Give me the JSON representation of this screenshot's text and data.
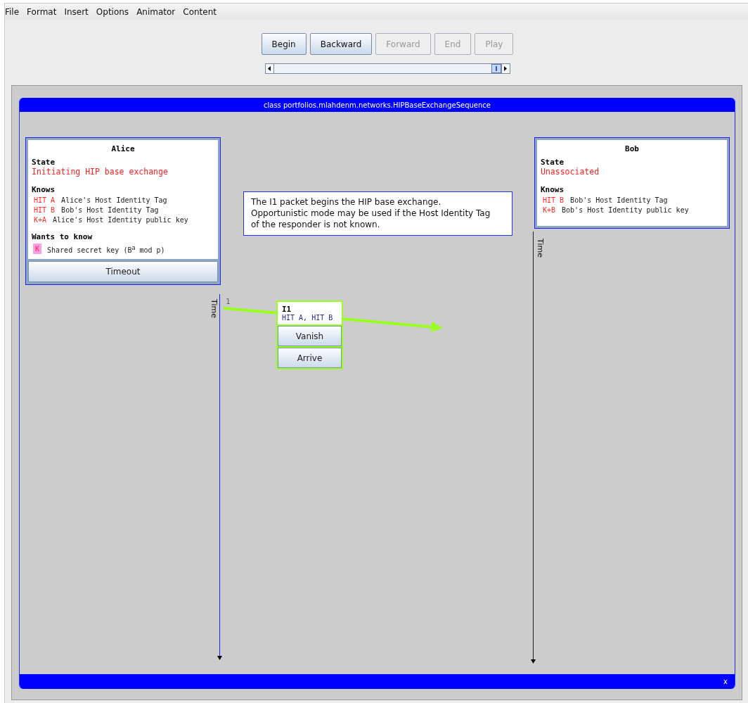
{
  "menu": [
    "File",
    "Format",
    "Insert",
    "Options",
    "Animator",
    "Content"
  ],
  "controls": [
    {
      "label": "Begin",
      "disabled": false
    },
    {
      "label": "Backward",
      "disabled": false
    },
    {
      "label": "Forward",
      "disabled": true
    },
    {
      "label": "End",
      "disabled": true
    },
    {
      "label": "Play",
      "disabled": true
    }
  ],
  "frame": {
    "title": "class portfolios.mlahdenm.networks.HIPBaseExchangeSequence",
    "close": "x"
  },
  "actors": [
    {
      "name": "Alice",
      "state_heading": "State",
      "state": "Initiating HIP base exchange",
      "knows_heading": "Knows",
      "knows": [
        {
          "tag": "HIT A",
          "desc": "Alice's Host Identity Tag",
          "highlight": false
        },
        {
          "tag": "HIT B",
          "desc": "Bob's Host Identity Tag",
          "highlight": false
        },
        {
          "tag": "K+A",
          "desc": "Alice's Host Identity public key",
          "highlight": false
        }
      ],
      "wants_heading": "Wants to know",
      "wants": [
        {
          "tag": "K",
          "desc": "Shared secret key (B$^{a}$ mod p)",
          "highlight": true
        }
      ],
      "buttons": [
        "Timeout"
      ],
      "time_label": "Time"
    },
    {
      "name": "Bob",
      "state_heading": "State",
      "state": "Unassociated",
      "knows_heading": "Knows",
      "knows": [
        {
          "tag": "HIT B",
          "desc": "Bob's Host Identity Tag",
          "highlight": false
        },
        {
          "tag": "K+B",
          "desc": "Bob's Host Identity public key",
          "highlight": false
        }
      ],
      "time_label": "Time"
    }
  ],
  "note": "The I1 packet begins the HIP base exchange. Opportunistic mode may be used if the Host Identity Tag of the responder is not known.",
  "messages": [
    {
      "index": "1",
      "name": "I1",
      "fields": "HIT A, HIT B",
      "buttons": [
        "Vanish",
        "Arrive"
      ]
    }
  ]
}
